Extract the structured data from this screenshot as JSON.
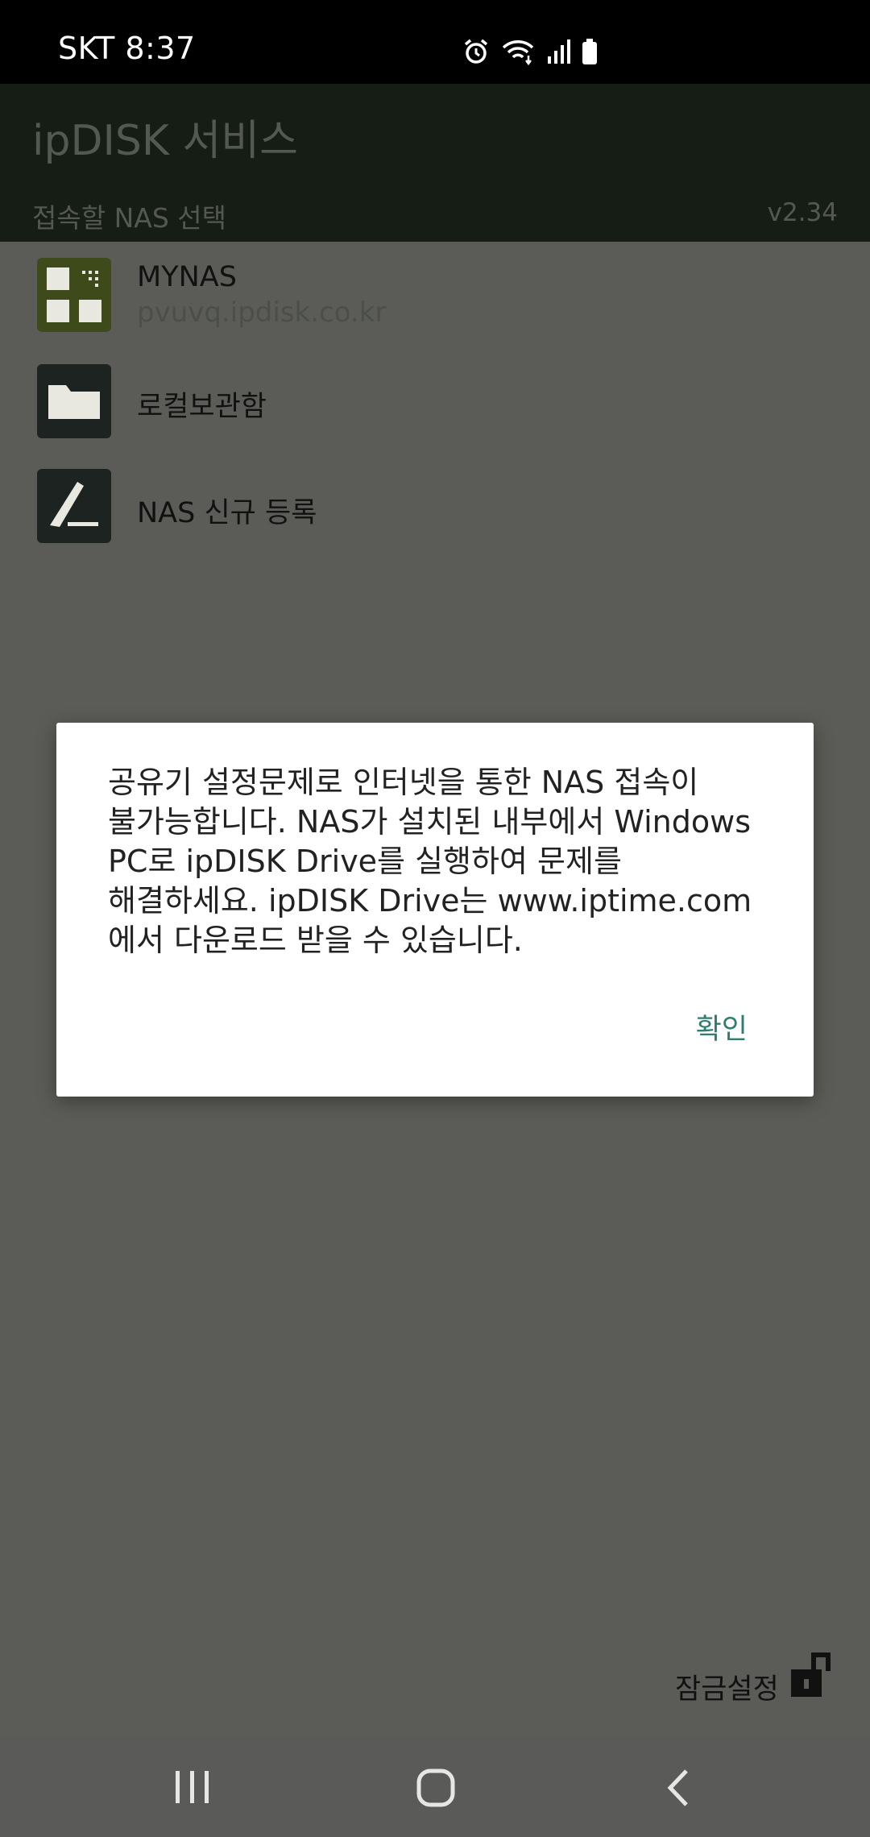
{
  "status_bar": {
    "time": "SKT 8:37",
    "icons": [
      "alarm-icon",
      "wifi-icon",
      "signal-icon",
      "battery-icon"
    ]
  },
  "header": {
    "title": "ipDISK 서비스",
    "subtitle": "접속할 NAS 선택",
    "version": "v2.34"
  },
  "list": {
    "items": [
      {
        "title": "MYNAS",
        "subtitle": "pvuvq.ipdisk.co.kr",
        "icon": "nas-grid-icon"
      },
      {
        "title": "로컬보관함",
        "icon": "folder-icon"
      },
      {
        "title": "NAS 신규 등록",
        "icon": "edit-pen-icon"
      }
    ]
  },
  "dialog": {
    "lines": [
      "공유기 설정문제로 인터넷을 통한 NAS 접속이",
      "불가능합니다. NAS가 설치된 내부에서 Windows",
      "PC로 ipDISK Drive를 실행하여 문제를",
      "해결하세요. ipDISK Drive는 www.iptime.com",
      "에서 다운로드 받을 수 있습니다."
    ],
    "ok_label": "확인"
  },
  "footer": {
    "lock_label": "잠금설정",
    "lock_icon": "unlock-icon"
  },
  "nav": {
    "buttons": [
      "recent-apps-icon",
      "home-icon",
      "back-icon"
    ]
  },
  "colors": {
    "header_bg": "#161d14",
    "overlay_bg": "#5b5c57",
    "nas_icon": "#3f4a1a",
    "folder_icon": "#1c2320",
    "accent": "#2e7d6e"
  }
}
